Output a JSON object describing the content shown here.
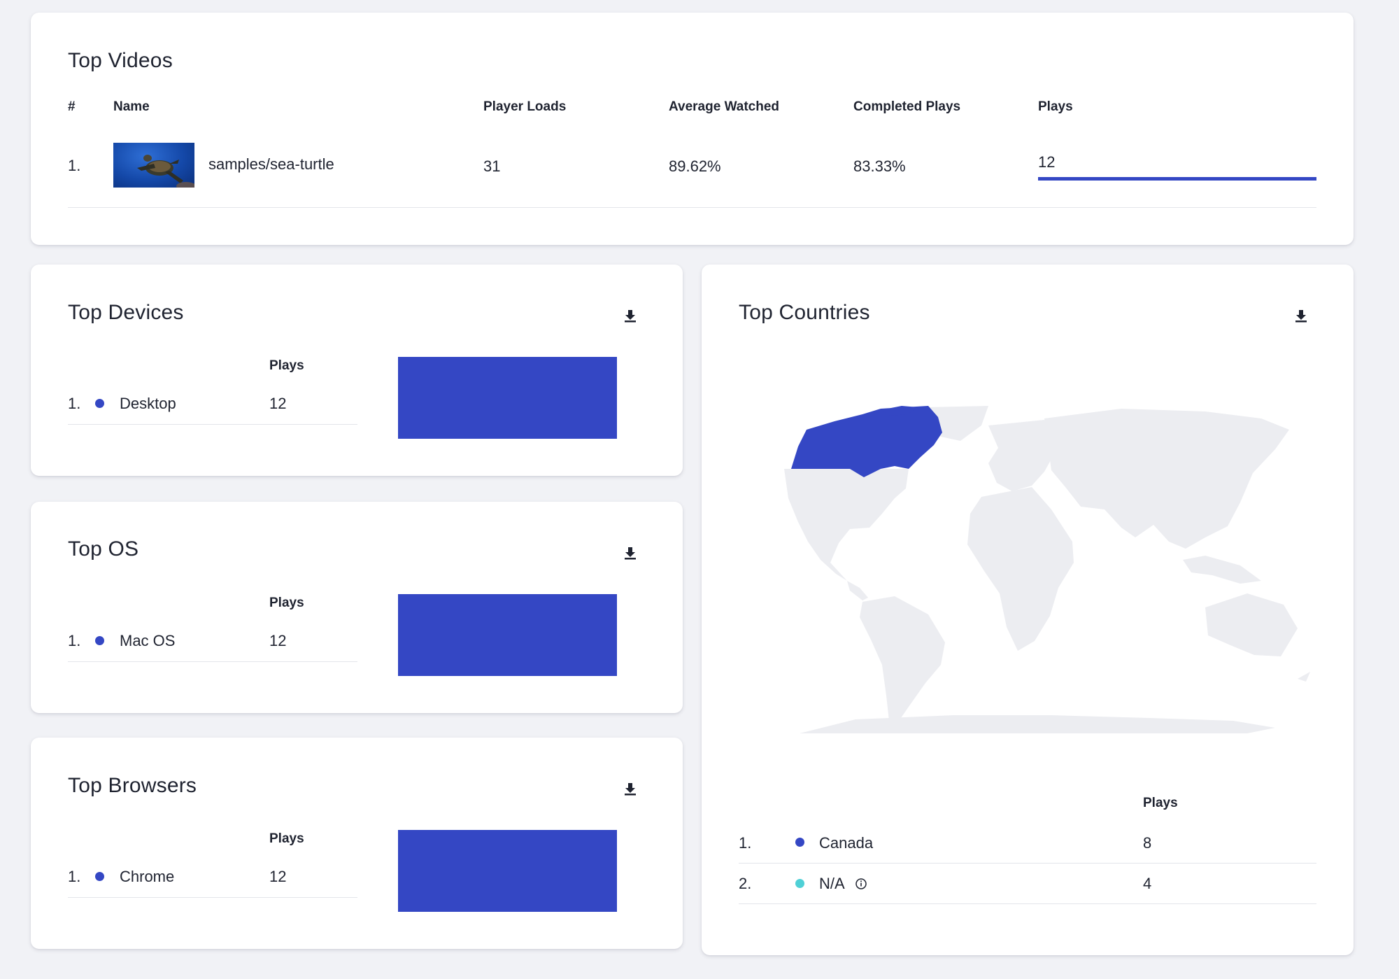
{
  "colors": {
    "accent": "#3447c4",
    "secondary": "#4fd0d6",
    "map_land": "#ecedf1"
  },
  "top_videos": {
    "title": "Top Videos",
    "columns": {
      "index": "#",
      "name": "Name",
      "player_loads": "Player Loads",
      "average_watched": "Average Watched",
      "completed_plays": "Completed Plays",
      "plays": "Plays"
    },
    "rows": [
      {
        "rank": "1.",
        "name": "samples/sea-turtle",
        "thumbnail_icon": "sea-turtle-thumbnail",
        "player_loads": "31",
        "average_watched": "89.62%",
        "completed_plays": "83.33%",
        "plays": "12",
        "plays_fraction": 1.0
      }
    ]
  },
  "top_devices": {
    "title": "Top Devices",
    "plays_header": "Plays",
    "download_icon": "download-icon",
    "rows": [
      {
        "rank": "1.",
        "label": "Desktop",
        "plays": "12"
      }
    ],
    "chart_data": {
      "type": "bar",
      "categories": [
        "Desktop"
      ],
      "values": [
        12
      ]
    }
  },
  "top_os": {
    "title": "Top OS",
    "plays_header": "Plays",
    "download_icon": "download-icon",
    "rows": [
      {
        "rank": "1.",
        "label": "Mac OS",
        "plays": "12"
      }
    ],
    "chart_data": {
      "type": "bar",
      "categories": [
        "Mac OS"
      ],
      "values": [
        12
      ]
    }
  },
  "top_browsers": {
    "title": "Top Browsers",
    "plays_header": "Plays",
    "download_icon": "download-icon",
    "rows": [
      {
        "rank": "1.",
        "label": "Chrome",
        "plays": "12"
      }
    ],
    "chart_data": {
      "type": "bar",
      "categories": [
        "Chrome"
      ],
      "values": [
        12
      ]
    }
  },
  "top_countries": {
    "title": "Top Countries",
    "plays_header": "Plays",
    "download_icon": "download-icon",
    "map_highlighted": "Canada",
    "rows": [
      {
        "rank": "1.",
        "label": "Canada",
        "plays": "8",
        "color": "#3447c4"
      },
      {
        "rank": "2.",
        "label": "N/A",
        "plays": "4",
        "color": "#4fd0d6",
        "info_icon": "info-icon"
      }
    ]
  }
}
